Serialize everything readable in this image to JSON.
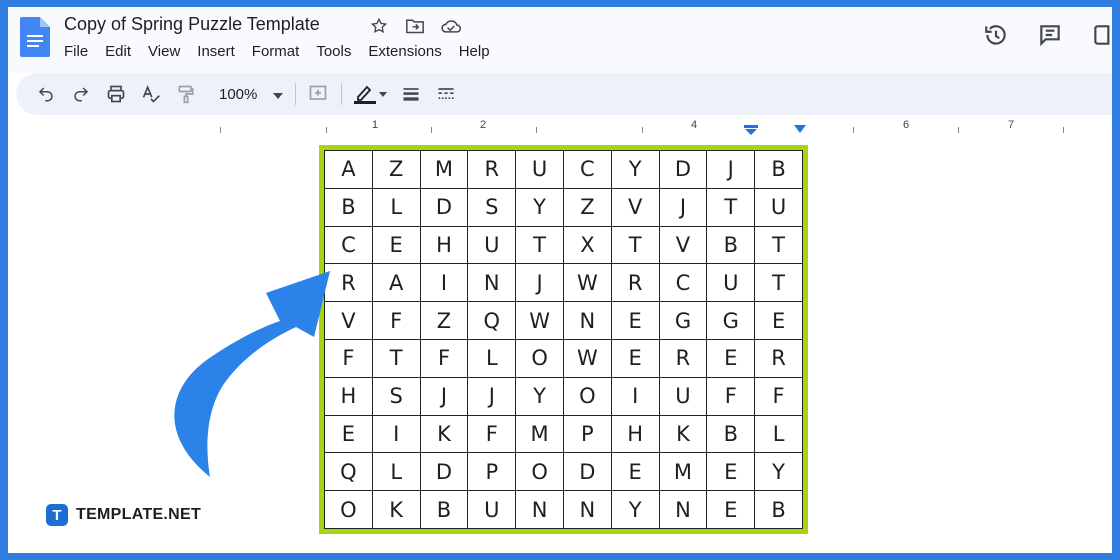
{
  "doc": {
    "title": "Copy of Spring Puzzle Template"
  },
  "menu": [
    "File",
    "Edit",
    "View",
    "Insert",
    "Format",
    "Tools",
    "Extensions",
    "Help"
  ],
  "toolbar": {
    "zoom": "100%"
  },
  "ruler": {
    "numbers": [
      "1",
      "2",
      "4",
      "6",
      "7"
    ]
  },
  "puzzle": {
    "rows": [
      [
        "A",
        "Z",
        "M",
        "R",
        "U",
        "C",
        "Y",
        "D",
        "J",
        "B"
      ],
      [
        "B",
        "L",
        "D",
        "S",
        "Y",
        "Z",
        "V",
        "J",
        "T",
        "U"
      ],
      [
        "C",
        "E",
        "H",
        "U",
        "T",
        "X",
        "T",
        "V",
        "B",
        "T"
      ],
      [
        "R",
        "A",
        "I",
        "N",
        "J",
        "W",
        "R",
        "C",
        "U",
        "T"
      ],
      [
        "V",
        "F",
        "Z",
        "Q",
        "W",
        "N",
        "E",
        "G",
        "G",
        "E"
      ],
      [
        "F",
        "T",
        "F",
        "L",
        "O",
        "W",
        "E",
        "R",
        "E",
        "R"
      ],
      [
        "H",
        "S",
        "J",
        "J",
        "Y",
        "O",
        "I",
        "U",
        "F",
        "F"
      ],
      [
        "E",
        "I",
        "K",
        "F",
        "M",
        "P",
        "H",
        "K",
        "B",
        "L"
      ],
      [
        "Q",
        "L",
        "D",
        "P",
        "O",
        "D",
        "E",
        "M",
        "E",
        "Y"
      ],
      [
        "O",
        "K",
        "B",
        "U",
        "N",
        "N",
        "Y",
        "N",
        "E",
        "B"
      ]
    ],
    "border_color": "#a8d412"
  },
  "brand": {
    "badge": "T",
    "name": "TEMPLATE.NET"
  },
  "colors": {
    "frame": "#2f7de1",
    "arrow": "#2b82e8",
    "toolbar_bg": "#edf2fa"
  }
}
